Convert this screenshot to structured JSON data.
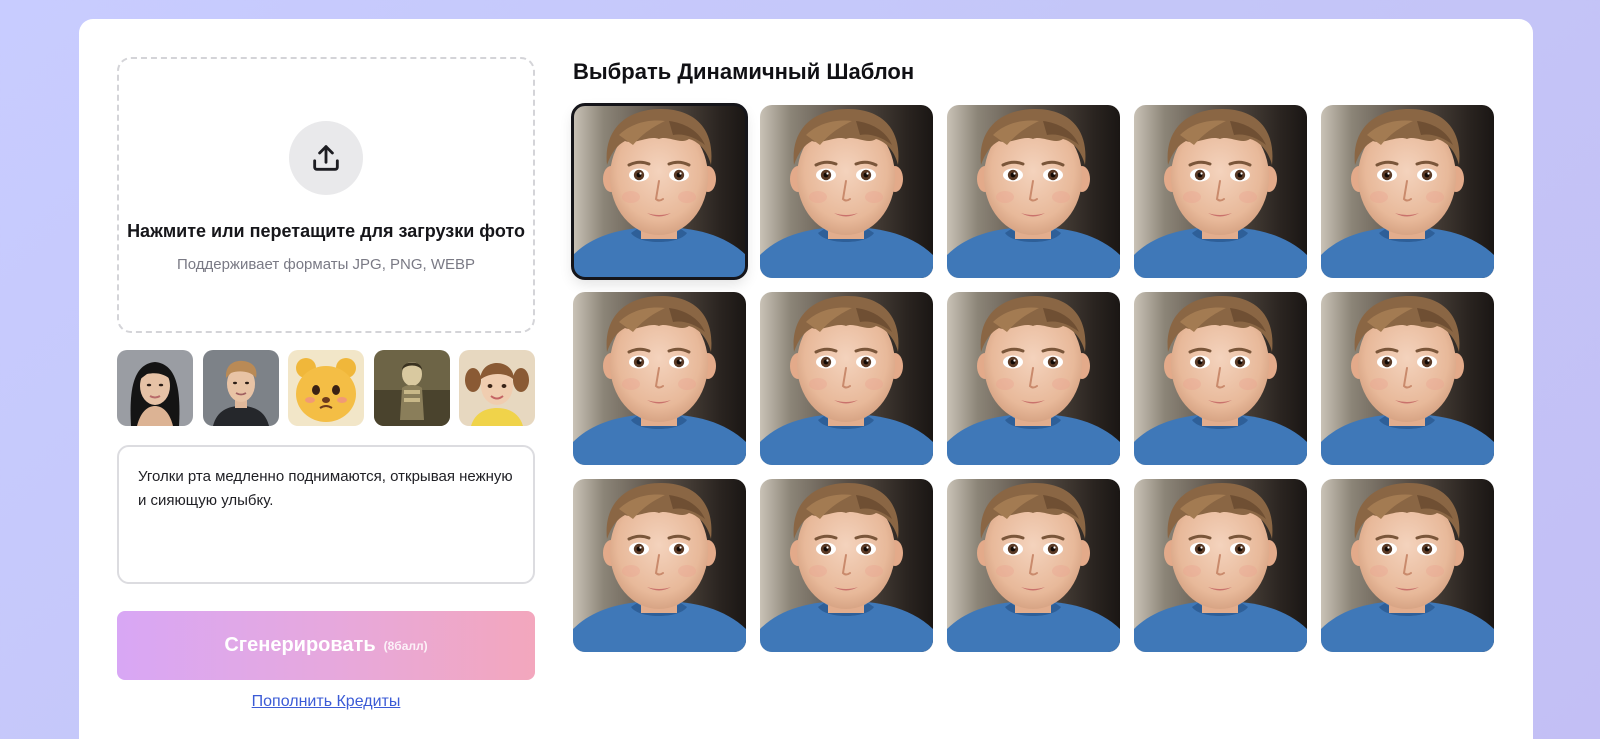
{
  "upload": {
    "icon": "upload-icon",
    "title": "Нажмите или перетащите для загрузки фото",
    "subtitle": "Поддерживает форматы JPG, PNG, WEBP"
  },
  "samples": [
    {
      "icon": "sample-woman-photo"
    },
    {
      "icon": "sample-man-photo"
    },
    {
      "icon": "sample-bear-photo"
    },
    {
      "icon": "sample-vintage-girl-photo"
    },
    {
      "icon": "sample-girl-photo"
    }
  ],
  "prompt": {
    "value": "Уголки рта медленно поднимаются, открывая нежную и сияющую улыбку."
  },
  "generate": {
    "label": "Сгенерировать",
    "cost": "(8балл)"
  },
  "topup_link": "Пополнить Кредиты",
  "templates": {
    "title": "Выбрать Динамичный Шаблон",
    "selected_index": 0,
    "count": 15
  },
  "colors": {
    "accent_gradient_start": "#d8a7f5",
    "accent_gradient_end": "#f3a7bd",
    "link": "#3b5bd6",
    "selected_outline": "#15151a"
  }
}
